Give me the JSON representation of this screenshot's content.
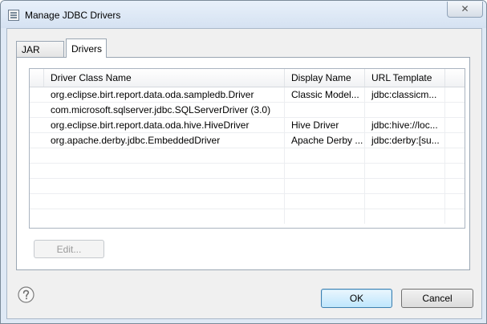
{
  "window": {
    "title": "Manage JDBC Drivers",
    "close_label": "✕"
  },
  "tabs": [
    {
      "label": "JAR Files"
    },
    {
      "label": "Drivers"
    }
  ],
  "table": {
    "columns": [
      "Driver Class Name",
      "Display Name",
      "URL Template"
    ],
    "rows": [
      {
        "class_name": "org.eclipse.birt.report.data.oda.sampledb.Driver",
        "display_name": "Classic Model...",
        "url_template": "jdbc:classicm..."
      },
      {
        "class_name": "com.microsoft.sqlserver.jdbc.SQLServerDriver (3.0)",
        "display_name": "",
        "url_template": ""
      },
      {
        "class_name": "org.eclipse.birt.report.data.oda.hive.HiveDriver",
        "display_name": "Hive Driver",
        "url_template": "jdbc:hive://loc..."
      },
      {
        "class_name": "org.apache.derby.jdbc.EmbeddedDriver",
        "display_name": "Apache Derby ...",
        "url_template": "jdbc:derby:[su..."
      }
    ]
  },
  "buttons": {
    "edit": "Edit...",
    "ok": "OK",
    "cancel": "Cancel"
  },
  "icons": {
    "title": "database-driver-icon",
    "help": "help-icon"
  },
  "colors": {
    "accent": "#3c7fb1",
    "window_frame": "#dfe9f5"
  }
}
